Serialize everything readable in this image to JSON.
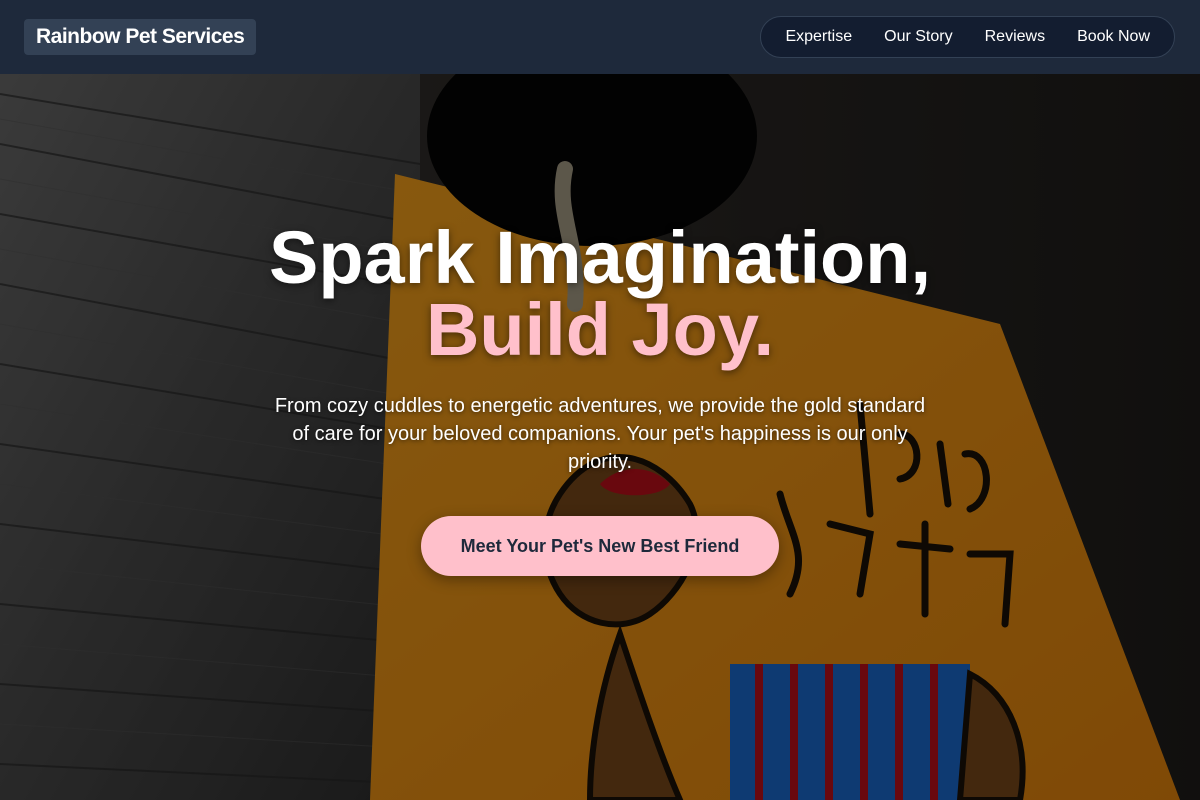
{
  "header": {
    "brand": "Rainbow Pet Services",
    "nav": [
      {
        "label": "Expertise"
      },
      {
        "label": "Our Story"
      },
      {
        "label": "Reviews"
      },
      {
        "label": "Book Now"
      }
    ]
  },
  "hero": {
    "headline_line1": "Spark Imagination,",
    "headline_line2": "Build Joy.",
    "subtext": "From cozy cuddles to energetic adventures, we provide the gold standard of care for your beloved companions. Your pet's happiness is our only priority.",
    "cta_label": "Meet Your Pet's New Best Friend",
    "background_description_icon": "dog-parking-sign-photo"
  },
  "colors": {
    "header_bg": "#1e293b",
    "accent_pink": "#ffc0cb",
    "cta_text": "#1e293b",
    "sign_orange": "#f5a020"
  }
}
